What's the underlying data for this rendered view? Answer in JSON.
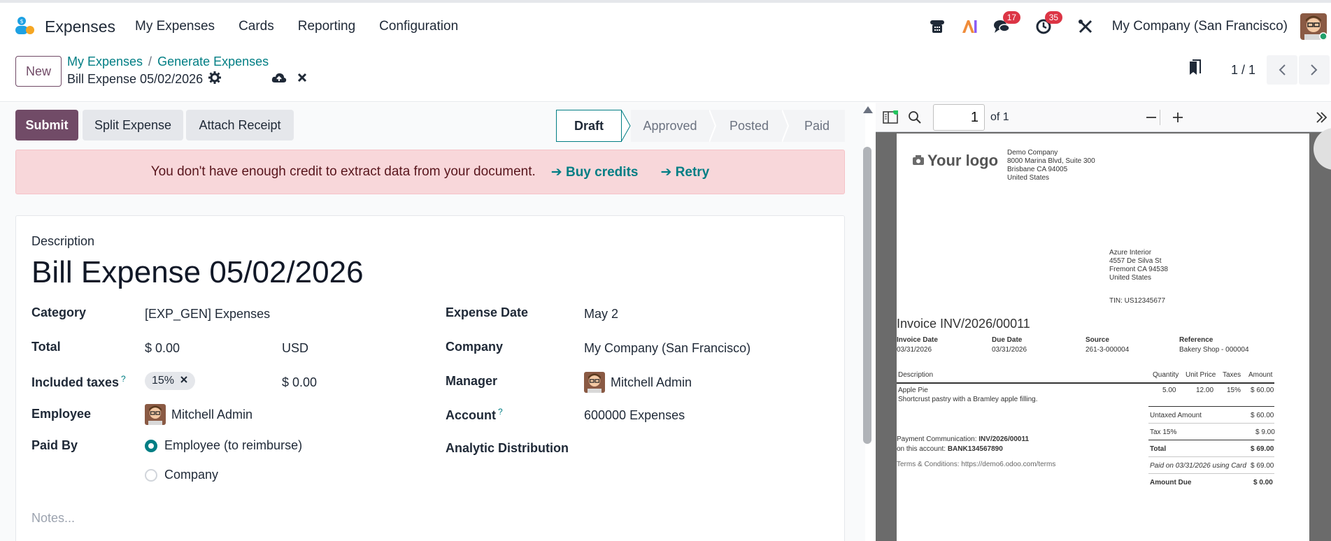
{
  "app": {
    "name": "Expenses"
  },
  "menu": [
    "My Expenses",
    "Cards",
    "Reporting",
    "Configuration"
  ],
  "systray": {
    "messages_count": "17",
    "activities_count": "35",
    "company": "My Company (San Francisco)"
  },
  "control": {
    "new_label": "New",
    "breadcrumb": [
      "My Expenses",
      "Generate Expenses"
    ],
    "breadcrumb_sep": "/",
    "record_title": "Bill Expense 05/02/2026",
    "pager": "1 / 1"
  },
  "actions": {
    "submit": "Submit",
    "split": "Split Expense",
    "attach": "Attach Receipt"
  },
  "stages": [
    "Draft",
    "Approved",
    "Posted",
    "Paid"
  ],
  "alert": {
    "text": "You don't have enough credit to extract data from your document.",
    "buy": "➔ Buy credits",
    "retry": "➔ Retry"
  },
  "form": {
    "description_label": "Description",
    "description": "Bill Expense 05/02/2026",
    "category_label": "Category",
    "category": "[EXP_GEN] Expenses",
    "total_label": "Total",
    "total": "$ 0.00",
    "currency": "USD",
    "taxes_label": "Included taxes",
    "tax_tag": "15%",
    "tax_amount": "$ 0.00",
    "employee_label": "Employee",
    "employee": "Mitchell Admin",
    "paid_by_label": "Paid By",
    "paid_by_options": [
      "Employee (to reimburse)",
      "Company"
    ],
    "expense_date_label": "Expense Date",
    "expense_date": "May 2",
    "company_label": "Company",
    "company": "My Company (San Francisco)",
    "manager_label": "Manager",
    "manager": "Mitchell Admin",
    "account_label": "Account",
    "account": "600000 Expenses",
    "analytic_label": "Analytic Distribution",
    "help_mark": "?",
    "notes_placeholder": "Notes..."
  },
  "pdf": {
    "page_value": "1",
    "of_pages": "of 1",
    "logo_text": "Your logo",
    "company_address": [
      "Demo Company",
      "8000 Marina Blvd, Suite 300",
      "Brisbane CA 94005",
      "United States"
    ],
    "customer_address": [
      "Azure Interior",
      "4557 De Silva St",
      "Fremont CA 94538",
      "United States"
    ],
    "tin": "TIN: US12345677",
    "invoice_title": "Invoice INV/2026/00011",
    "meta": [
      {
        "label": "Invoice Date",
        "value": "03/31/2026"
      },
      {
        "label": "Due Date",
        "value": "03/31/2026"
      },
      {
        "label": "Source",
        "value": "261-3-000004"
      },
      {
        "label": "Reference",
        "value": "Bakery Shop - 000004"
      }
    ],
    "table_headers": [
      "Description",
      "Quantity",
      "Unit Price",
      "Taxes",
      "Amount"
    ],
    "line": {
      "name": "Apple Pie",
      "note": "Shortcrust pastry with a Bramley apple filling.",
      "qty": "5.00",
      "price": "12.00",
      "tax": "15%",
      "amount": "$ 60.00"
    },
    "totals": [
      {
        "label": "Untaxed Amount",
        "value": "$ 60.00"
      },
      {
        "label": "Tax 15%",
        "value": "$ 9.00"
      },
      {
        "label": "Total",
        "value": "$ 69.00"
      },
      {
        "label": "Paid on 03/31/2026 using Card",
        "value": "$ 69.00"
      },
      {
        "label": "Amount Due",
        "value": "$ 0.00"
      }
    ],
    "payment_comm_label": "Payment Communication:",
    "payment_comm": "INV/2026/00011",
    "account_label": "on this account:",
    "account": "BANK134567890",
    "terms": "Terms & Conditions: https://demo6.odoo.com/terms"
  },
  "colors": {
    "brand": "#714b67",
    "link": "#017e84",
    "alert_bg": "#f8d7da",
    "badge": "#dc3545"
  }
}
